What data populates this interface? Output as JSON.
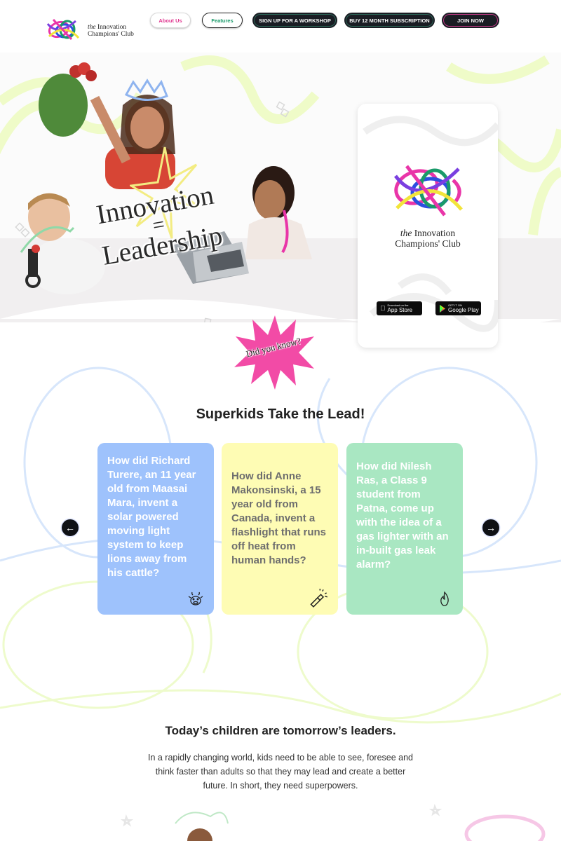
{
  "header": {
    "logo_prefix": "the",
    "logo_line1": "Innovation",
    "logo_line2": "Champions' Club",
    "nav": [
      {
        "label": "About Us",
        "color": "#e0358f"
      },
      {
        "label": "Features",
        "color": "#1a9a6a"
      },
      {
        "label": "SIGN UP FOR A WORKSHOP"
      },
      {
        "label": "BUY 12 MONTH SUBSCRIPTION"
      },
      {
        "label": "JOIN NOW"
      }
    ]
  },
  "hero": {
    "headline_line1": "Innovation",
    "headline_line2": "=",
    "headline_line3": "Leadership"
  },
  "app_card": {
    "title_prefix": "the",
    "title_line1": "Innovation",
    "title_line2": "Champions' Club",
    "app_store": {
      "small": "Download on the",
      "big": "App Store"
    },
    "google_play": {
      "small": "GET IT ON",
      "big": "Google Play"
    }
  },
  "did_you_know": "Did you know?",
  "section_title": "Superkids Take the Lead!",
  "cards": [
    {
      "text": "How did Richard Turere, an 11 year old from Maasai Mara, invent a solar powered moving light system to keep lions away from his cattle?",
      "color": "#9ec2fc",
      "text_color": "#ffffff",
      "icon": "cow-icon"
    },
    {
      "text": "How did Anne Makonsinski, a 15 year old from Canada, invent a flashlight that runs off heat from human hands?",
      "color": "#fefcb4",
      "text_color": "#6e6e6e",
      "icon": "flashlight-icon"
    },
    {
      "text": "How did Nilesh Ras, a Class 9 student from Patna, come up with the idea of a gas lighter with an in-built gas leak alarm?",
      "color": "#a9e7c2",
      "text_color": "#ffffff",
      "icon": "flame-icon"
    }
  ],
  "carousel": {
    "prev": "←",
    "next": "→"
  },
  "subhead": "Today’s children are tomorrow’s leaders.",
  "paragraph": "In a rapidly changing world, kids need to be able to see, foresee and think faster than adults so that they may lead and create a better future. In short, they need superpowers."
}
